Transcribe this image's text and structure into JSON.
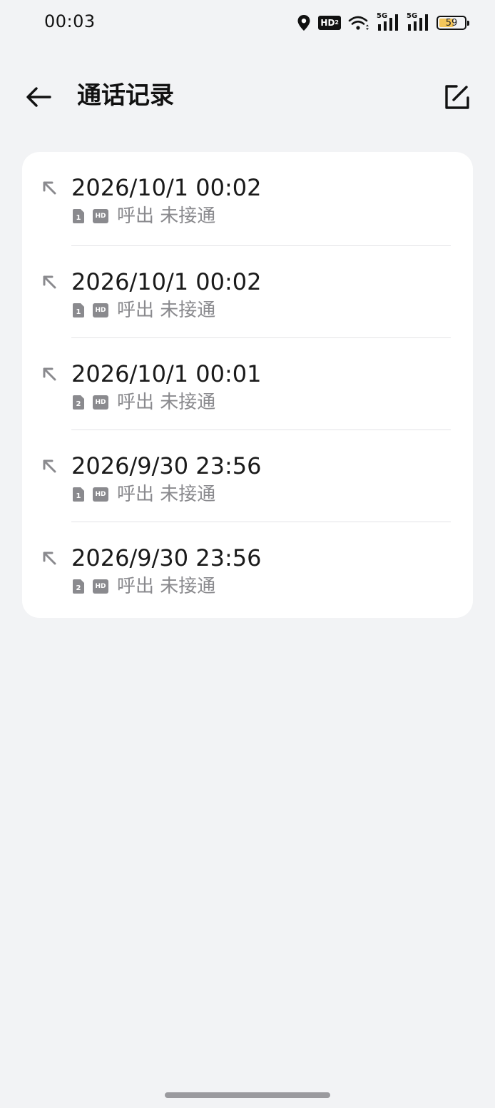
{
  "status_bar": {
    "time": "00:03",
    "network_1": "5G",
    "network_2": "5G",
    "hd_label": "HD",
    "hd_sub": "2",
    "battery_level": "59",
    "battery_fraction": 0.59,
    "battery_color": "#f3c55a"
  },
  "header": {
    "title": "通话记录",
    "back_icon": "arrow-left-icon",
    "edit_icon": "edit-icon"
  },
  "calls": [
    {
      "time": "2026/10/1 00:02",
      "sim": "1",
      "hd": "HD",
      "status": "呼出 未接通"
    },
    {
      "time": "2026/10/1 00:02",
      "sim": "1",
      "hd": "HD",
      "status": "呼出 未接通"
    },
    {
      "time": "2026/10/1 00:01",
      "sim": "2",
      "hd": "HD",
      "status": "呼出 未接通"
    },
    {
      "time": "2026/9/30 23:56",
      "sim": "1",
      "hd": "HD",
      "status": "呼出 未接通"
    },
    {
      "time": "2026/9/30 23:56",
      "sim": "2",
      "hd": "HD",
      "status": "呼出 未接通"
    }
  ]
}
